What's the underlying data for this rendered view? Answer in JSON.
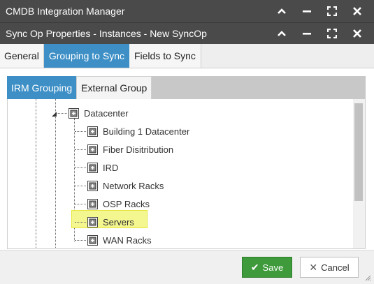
{
  "window": {
    "title": "CMDB Integration Manager"
  },
  "dialog": {
    "title": "Sync Op Properties - Instances - New SyncOp"
  },
  "tabs": [
    {
      "label": "General"
    },
    {
      "label": "Grouping to Sync"
    },
    {
      "label": "Fields to Sync"
    }
  ],
  "active_tab": "Grouping to Sync",
  "subtabs": [
    {
      "label": "IRM Grouping"
    },
    {
      "label": "External Group"
    }
  ],
  "active_subtab": "IRM Grouping",
  "tree": {
    "parent": {
      "label": "Datacenter",
      "icon": "network-node-icon"
    },
    "children": [
      {
        "label": "Building 1 Datacenter"
      },
      {
        "label": "Fiber Disitribution"
      },
      {
        "label": "IRD"
      },
      {
        "label": "Network Racks"
      },
      {
        "label": "OSP Racks"
      },
      {
        "label": "Servers"
      },
      {
        "label": "WAN Racks"
      }
    ],
    "selected": "Servers"
  },
  "footer": {
    "save_label": "Save",
    "cancel_label": "Cancel"
  },
  "colors": {
    "titlebar": "#4a4a4a",
    "active_tab": "#3d8fc6",
    "save": "#3e9a3a",
    "highlight": "#f4f790"
  }
}
